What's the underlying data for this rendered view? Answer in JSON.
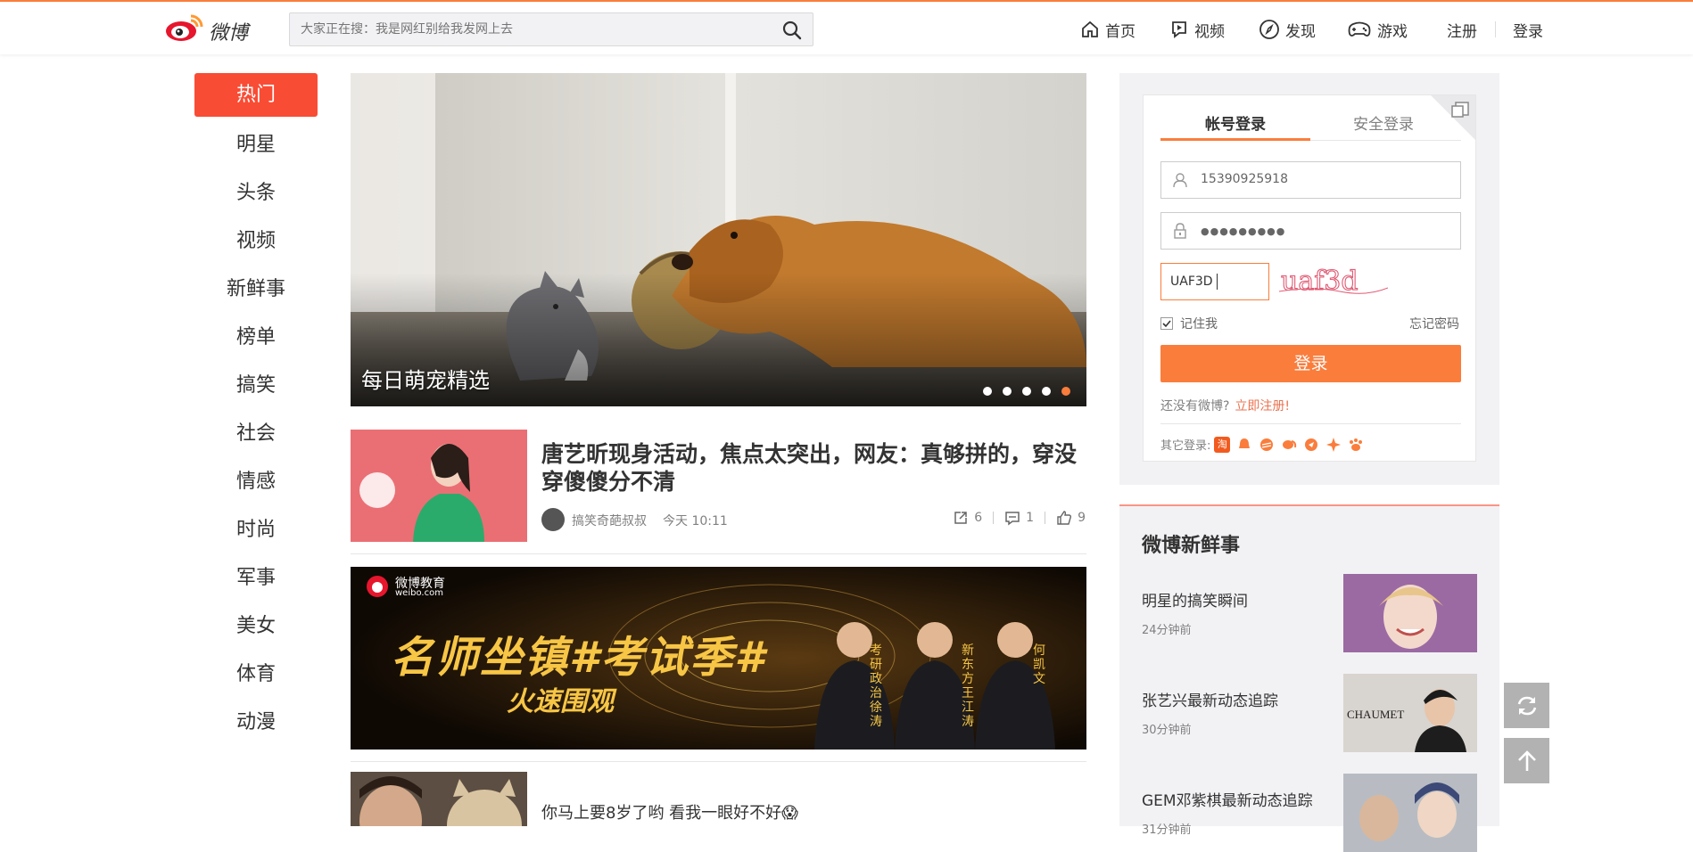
{
  "brand": {
    "name": "微博",
    "accent": "#fa7d3c",
    "red": "#f94c34"
  },
  "search": {
    "placeholder": "大家正在搜：我是网红别给我发网上去"
  },
  "nav": {
    "home": "首页",
    "video": "视频",
    "discover": "发现",
    "games": "游戏",
    "register": "注册",
    "login": "登录"
  },
  "sidebar": {
    "items": [
      "热门",
      "明星",
      "头条",
      "视频",
      "新鲜事",
      "榜单",
      "搞笑",
      "社会",
      "情感",
      "时尚",
      "军事",
      "美女",
      "体育",
      "动漫"
    ],
    "active_index": 0
  },
  "hero": {
    "caption": "每日萌宠精选",
    "slide_count": 5,
    "active_slide": 5
  },
  "news": [
    {
      "title": "唐艺昕现身活动，焦点太突出，网友：真够拼的，穿没穿傻傻分不清",
      "author": "搞笑奇葩叔叔",
      "time": "今天 10:11",
      "reposts": "6",
      "comments": "1",
      "likes": "9"
    },
    {
      "title": "你马上要8岁了哟 看我一眼好不好😱"
    }
  ],
  "banner": {
    "brand": "微博教育",
    "brand_url": "weibo.com",
    "main": "名师坐镇#考试季#",
    "sub": "火速围观",
    "teachers": [
      {
        "label": "考研政治",
        "name": "徐涛"
      },
      {
        "label": "新东方",
        "name": "王江涛"
      },
      {
        "label": "",
        "name": "何凯文"
      }
    ]
  },
  "login": {
    "tab_account": "帐号登录",
    "tab_secure": "安全登录",
    "username": "15390925918",
    "password_mask": "●●●●●●●●●",
    "captcha_value": "UAF3D",
    "captcha_image_text": "uaf3d",
    "remember": "记住我",
    "forgot": "忘记密码",
    "submit": "登录",
    "no_account": "还没有微博?",
    "register_now": "立即注册!",
    "other_login": "其它登录:",
    "other_icons": [
      "淘",
      "qq",
      "weibo",
      "wechat",
      "baidu",
      "360",
      "paw"
    ]
  },
  "fresh": {
    "title": "微博新鲜事",
    "items": [
      {
        "title": "明星的搞笑瞬间",
        "time": "24分钟前"
      },
      {
        "title": "张艺兴最新动态追踪",
        "time": "30分钟前"
      },
      {
        "title": "GEM邓紫棋最新动态追踪",
        "time": "31分钟前"
      }
    ]
  }
}
